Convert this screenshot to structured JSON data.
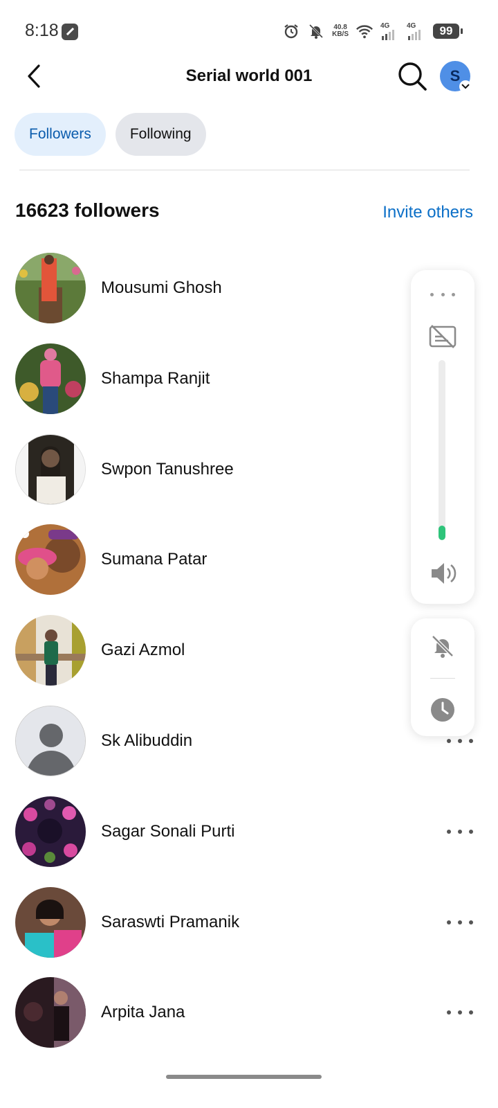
{
  "status_bar": {
    "time": "8:18",
    "net_speed_value": "40.8",
    "net_speed_unit": "KB/S",
    "sim1": "4G",
    "sim2": "4G",
    "battery": "99"
  },
  "header": {
    "title": "Serial world 001",
    "profile_initial": "S"
  },
  "tabs": [
    {
      "label": "Followers",
      "active": true
    },
    {
      "label": "Following",
      "active": false
    }
  ],
  "summary": {
    "count": "16623 followers",
    "invite": "Invite others"
  },
  "followers": [
    {
      "name": "Mousumi Ghosh"
    },
    {
      "name": "Shampa Ranjit"
    },
    {
      "name": "Swpon Tanushree"
    },
    {
      "name": "Sumana Patar"
    },
    {
      "name": "Gazi Azmol"
    },
    {
      "name": "Sk Alibuddin"
    },
    {
      "name": "Sagar Sonali Purti"
    },
    {
      "name": "Saraswti Pramanik"
    },
    {
      "name": "Arpita Jana"
    }
  ],
  "volume_panel": {
    "level": 0.08
  },
  "colors": {
    "accent": "#0b6fc7",
    "tab_active_bg": "#e3effc",
    "volume_fill": "#2ec47a"
  }
}
